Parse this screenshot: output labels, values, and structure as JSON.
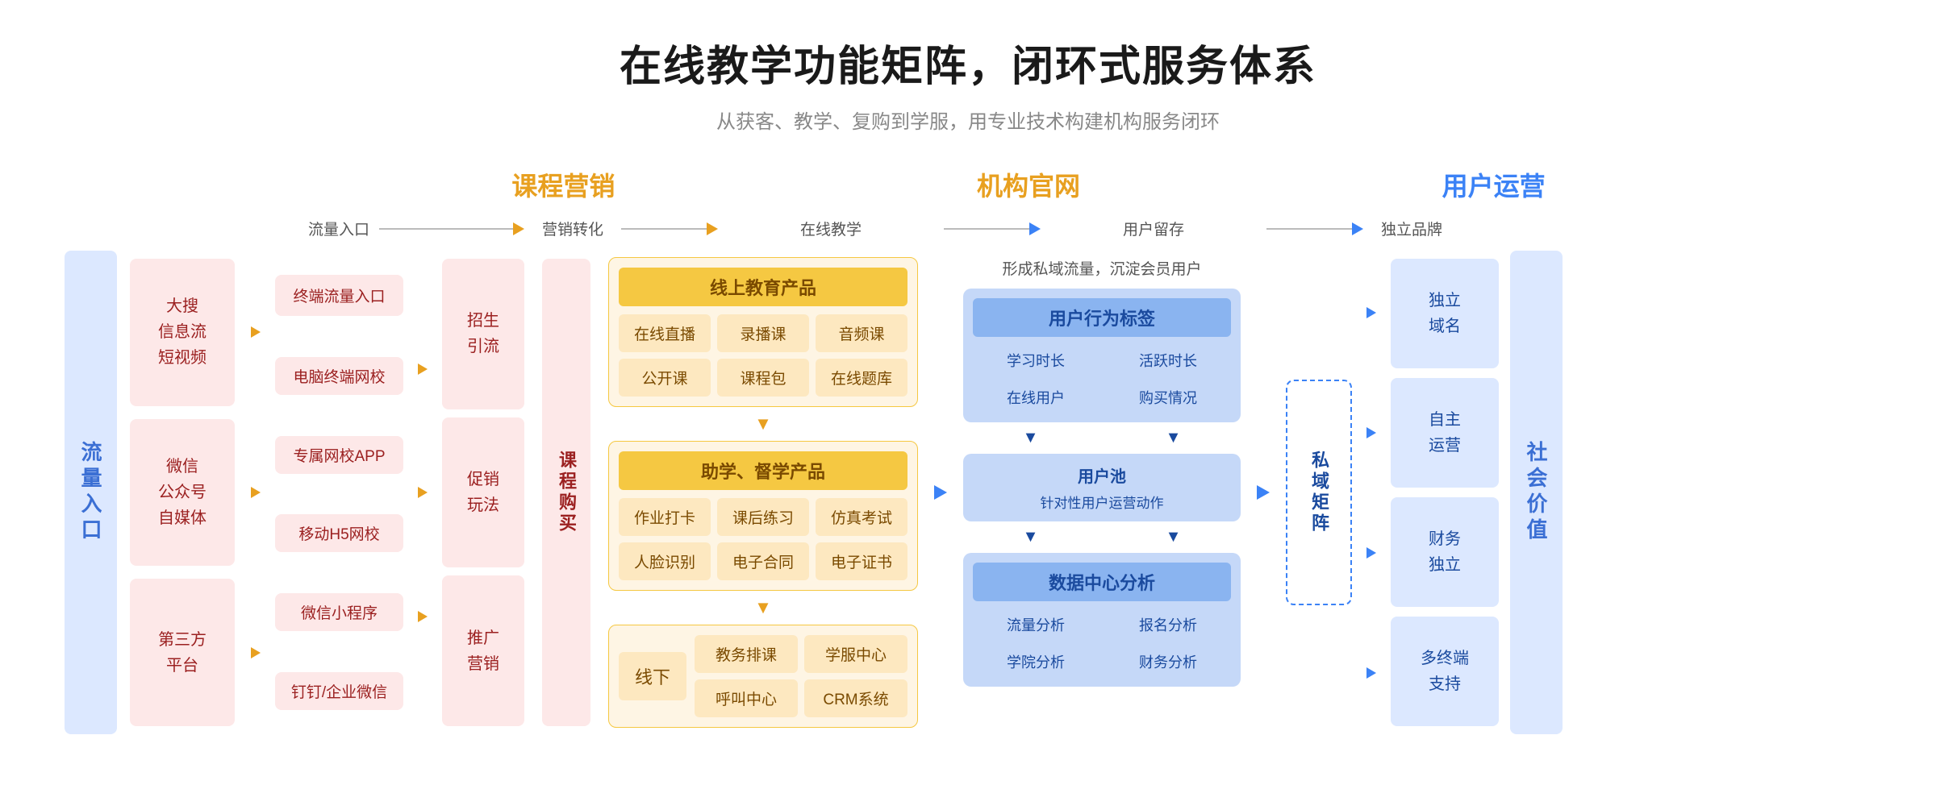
{
  "header": {
    "title": "在线教学功能矩阵，闭环式服务体系",
    "subtitle": "从获客、教学、复购到学服，用专业技术构建机构服务闭环"
  },
  "categories": {
    "marketing": "课程营销",
    "website": "机构官网",
    "operations": "用户运营"
  },
  "flow_nodes": {
    "traffic": "流量入口",
    "conversion": "营销转化",
    "online": "在线教学",
    "retention": "用户留存",
    "brand": "独立品牌"
  },
  "left_label": "流量入口",
  "right_label": "社会价值",
  "traffic_sources": [
    {
      "text": "大搜\n信息流\n短视频"
    },
    {
      "text": "微信\n公众号\n自媒体"
    },
    {
      "text": "第三方\n平台"
    }
  ],
  "terminal_entries": [
    {
      "text": "终端流量入口"
    },
    {
      "text": "电脑终端网校"
    },
    {
      "text": "专属网校APP"
    },
    {
      "text": "移动H5网校"
    },
    {
      "text": "微信小程序"
    },
    {
      "text": "钉钉/企业微信"
    }
  ],
  "conversion_boxes": [
    {
      "text": "招生\n引流"
    },
    {
      "text": "促销\n玩法"
    },
    {
      "text": "推广\n营销"
    }
  ],
  "course_buy_label": "课程购买",
  "online_products": {
    "section_title": "线上教育产品",
    "items": [
      "在线直播",
      "录播课",
      "音频课",
      "公开课",
      "课程包",
      "在线题库"
    ]
  },
  "assist_products": {
    "section_title": "助学、督学产品",
    "items": [
      "作业打卡",
      "课后练习",
      "仿真考试",
      "人脸识别",
      "电子合同",
      "电子证书"
    ]
  },
  "offline": {
    "label": "线下",
    "items": [
      "教务排课",
      "学服中心",
      "呼叫中心",
      "CRM系统"
    ]
  },
  "user_retention": {
    "note": "形成私域流量，沉淀会员用户",
    "behavior_tags": {
      "title": "用户行为标签",
      "items": [
        "学习时长",
        "活跃时长",
        "在线用户",
        "购买情况"
      ]
    },
    "user_pool": {
      "title": "用户池",
      "subtitle": "针对性用户运营动作"
    },
    "data_center": {
      "title": "数据中心分析",
      "items": [
        "流量分析",
        "报名分析",
        "学院分析",
        "财务分析"
      ]
    }
  },
  "private_domain": {
    "title": "私域矩阵"
  },
  "brand_items": [
    {
      "text": "独立\n域名"
    },
    {
      "text": "自主\n运营"
    },
    {
      "text": "财务\n独立"
    },
    {
      "text": "多终端\n支持"
    }
  ]
}
